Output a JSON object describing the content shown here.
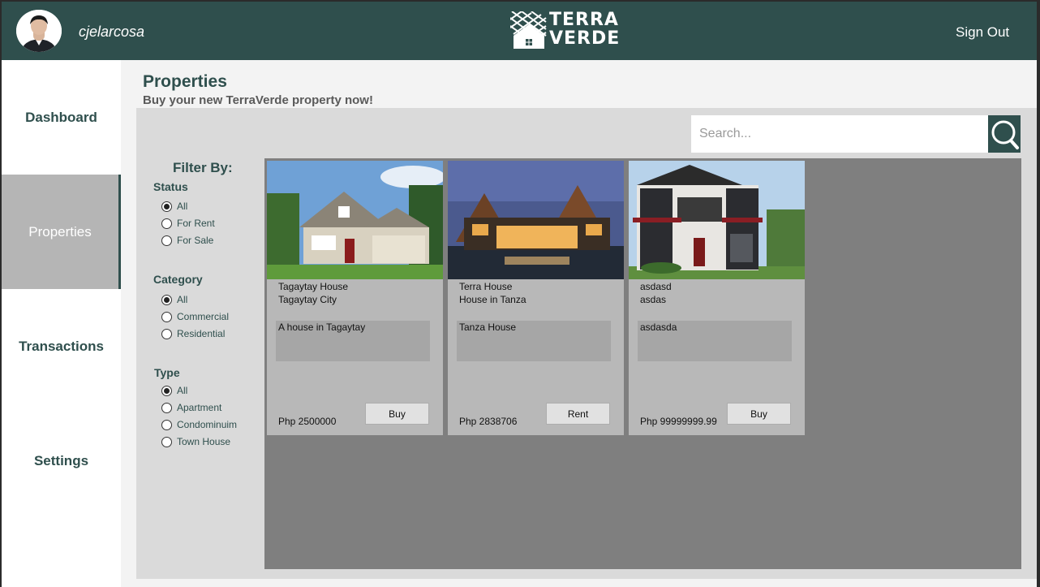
{
  "header": {
    "username": "cjelarcosa",
    "logo_line1": "TERRA",
    "logo_line2": "VERDE",
    "signout_label": "Sign Out"
  },
  "sidebar": {
    "items": [
      {
        "label": "Dashboard"
      },
      {
        "label": "Properties",
        "active": true
      },
      {
        "label": "Transactions"
      },
      {
        "label": "Settings"
      }
    ]
  },
  "main": {
    "title": "Properties",
    "subtitle": "Buy your new TerraVerde property now!",
    "search_placeholder": "Search..."
  },
  "filters": {
    "title": "Filter By:",
    "status": {
      "label": "Status",
      "options": [
        "All",
        "For Rent",
        "For Sale"
      ],
      "selected": "All"
    },
    "category": {
      "label": "Category",
      "options": [
        "All",
        "Commercial",
        "Residential"
      ],
      "selected": "All"
    },
    "type": {
      "label": "Type",
      "options": [
        "All",
        "Apartment",
        "Condominuim",
        "Town House"
      ],
      "selected": "All"
    }
  },
  "properties": [
    {
      "name": "Tagaytay House",
      "location": "Tagaytay City",
      "description": "A house in Tagaytay",
      "price": "Php 2500000",
      "action": "Buy"
    },
    {
      "name": "Terra House",
      "location": "House in Tanza",
      "description": "Tanza House",
      "price": "Php 2838706",
      "action": "Rent"
    },
    {
      "name": "asdasd",
      "location": "asdas",
      "description": "asdasda",
      "price": "Php 99999999.99",
      "action": "Buy"
    }
  ],
  "colors": {
    "header": "#2f4f4d",
    "sidebar_active": "#b5b5b5",
    "listing_bg": "#7f7f7f",
    "card_bg": "#b8b8b8"
  }
}
